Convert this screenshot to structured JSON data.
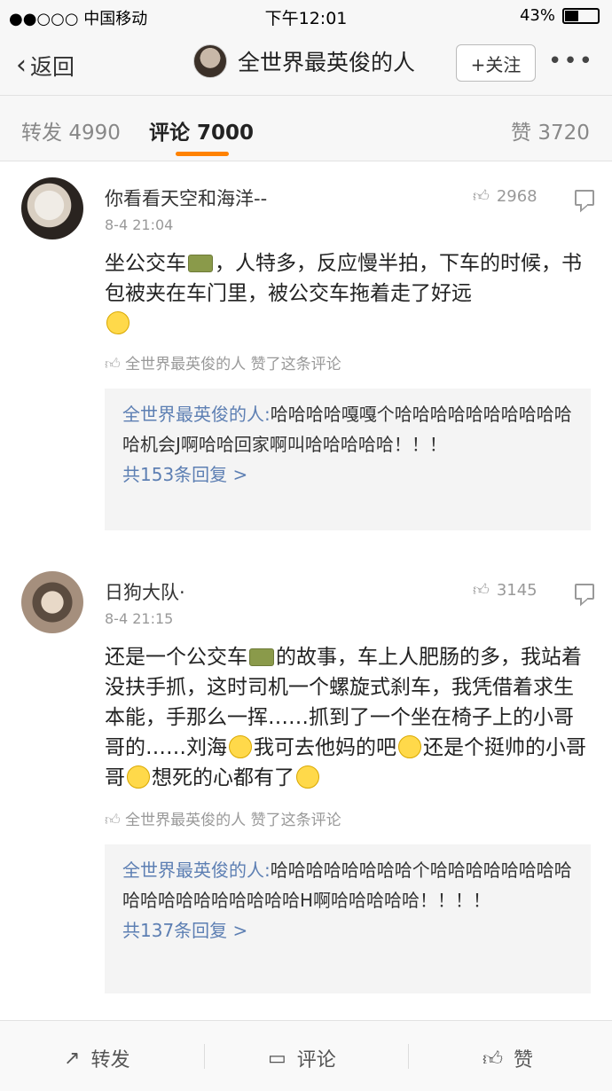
{
  "status_bar": {
    "carrier": "●●○○○ 中国移动",
    "time": "下午12:01",
    "battery": "43%",
    "battery_level": 0.43
  },
  "nav": {
    "back_label": "返回",
    "title": "全世界最英俊的人",
    "follow_label": "+关注",
    "more": "•••"
  },
  "tabs": [
    {
      "label": "转发",
      "count": "4990"
    },
    {
      "label": "评论",
      "count": "7000"
    },
    {
      "label": "赞",
      "count": "3720"
    }
  ],
  "comments": [
    {
      "user": "你看看天空和海洋--",
      "date": "8-4 21:04",
      "likes": "2968",
      "text_parts": [
        "坐公交车",
        "，人特多，反应慢半拍，下车的时候，书包被夹在车门里，被公交车拖着走了好远"
      ],
      "liked_by": "全世界最英俊的人 赞了这条评论",
      "reply": {
        "user": "全世界最英俊的人:",
        "text": "哈哈哈哈嘎嘎个哈哈哈哈哈哈哈哈哈哈哈机会J啊哈哈回家啊叫哈哈哈哈哈！！！",
        "count": "共153条回复 >"
      }
    },
    {
      "user": "日狗大队·",
      "date": "8-4 21:15",
      "likes": "3145",
      "text_parts": [
        "还是一个公交车",
        "的故事，车上人肥肠的多，我站着没扶手抓，这时司机一个螺旋式刹车，我凭借着求生本能，手那么一挥……抓到了一个坐在椅子上的小哥哥的……刘海",
        "我可去他妈的吧",
        "还是个挺帅的小哥哥",
        "想死的心都有了"
      ],
      "liked_by": "全世界最英俊的人 赞了这条评论",
      "reply": {
        "user": "全世界最英俊的人:",
        "text": "哈哈哈哈哈哈哈哈个哈哈哈哈哈哈哈哈哈哈哈哈哈哈哈哈哈哈H啊哈哈哈哈哈！！！！",
        "count": "共137条回复 >"
      }
    }
  ],
  "bottom_bar": {
    "repost": "转发",
    "comment": "评论",
    "like": "赞"
  }
}
